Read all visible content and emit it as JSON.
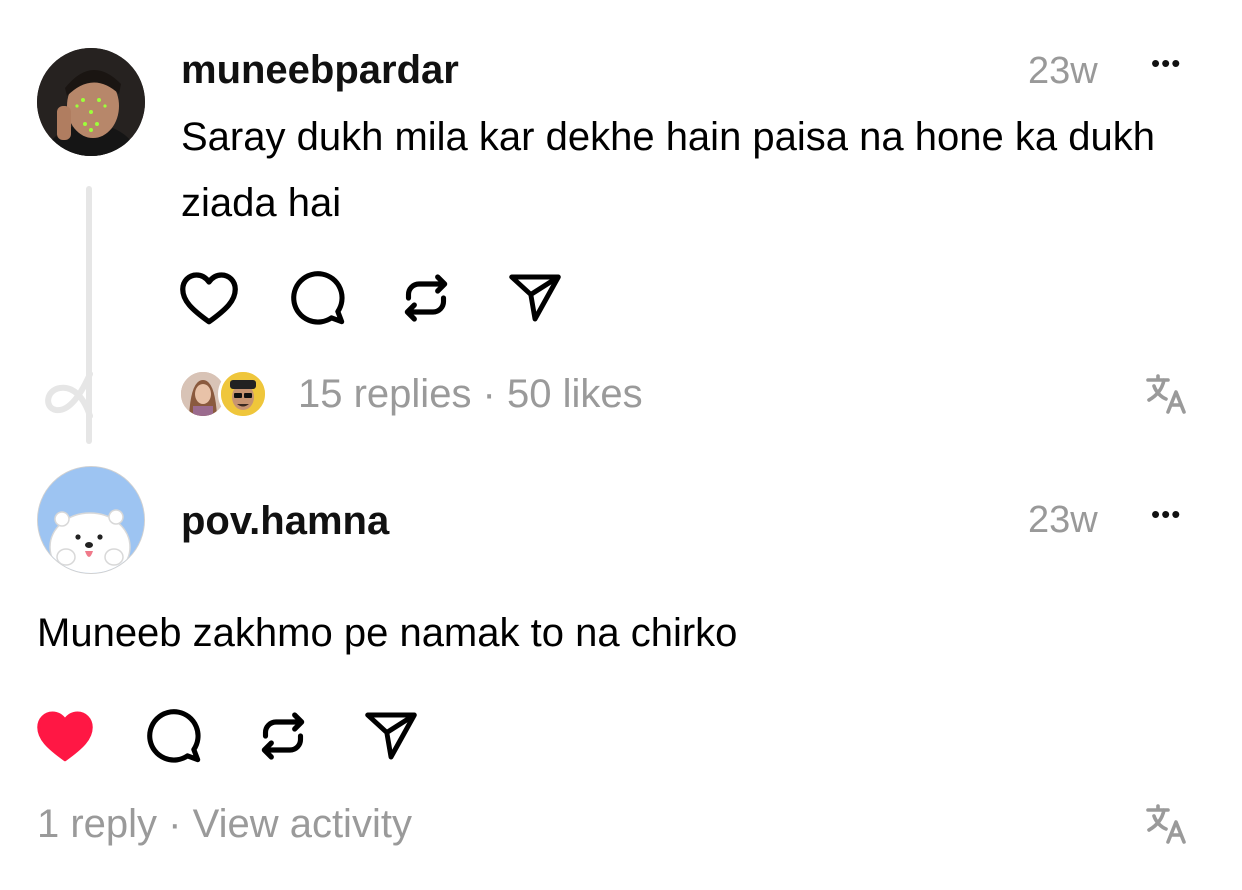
{
  "colors": {
    "like_active": "#ff1744",
    "muted": "#999999",
    "thread_line": "#e6e6e6"
  },
  "post": {
    "username": "muneebpardar",
    "time": "23w",
    "more_label": "•••",
    "text": "Saray dukh mila kar dekhe hain paisa na hone ka dukh ziada hai",
    "replies_summary": "15 replies · 50 likes",
    "icons": [
      "heart-outline-icon",
      "comment-icon",
      "repost-icon",
      "share-icon",
      "translate-icon"
    ]
  },
  "reply": {
    "username": "pov.hamna",
    "time": "23w",
    "more_label": "•••",
    "text": "Muneeb zakhmo pe namak to na chirko",
    "summary": "1 reply · View activity",
    "liked": true,
    "icons": [
      "heart-filled-icon",
      "comment-icon",
      "repost-icon",
      "share-icon",
      "translate-icon"
    ]
  }
}
